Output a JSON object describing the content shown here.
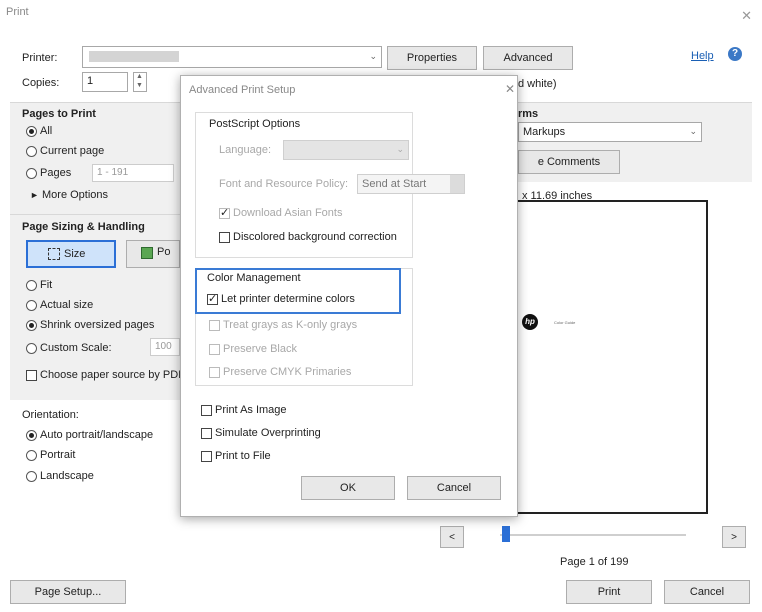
{
  "window": {
    "title": "Print",
    "close": "✕"
  },
  "printer": {
    "label": "Printer:",
    "name": "",
    "properties": "Properties",
    "advanced": "Advanced",
    "help": "Help"
  },
  "copies": {
    "label": "Copies:",
    "value": "1",
    "partial_right": "d white)"
  },
  "pages": {
    "title": "Pages to Print",
    "all": "All",
    "current": "Current page",
    "pages": "Pages",
    "pages_value": "1 - 191",
    "more": "More Options"
  },
  "sizing": {
    "title": "Page Sizing & Handling",
    "size_btn": "Size",
    "poster_btn": "Po",
    "fit": "Fit",
    "actual": "Actual size",
    "shrink": "Shrink oversized pages",
    "custom": "Custom Scale:",
    "custom_value": "100",
    "choose_paper": "Choose paper source by PDF"
  },
  "orientation": {
    "title": "Orientation:",
    "auto": "Auto portrait/landscape",
    "portrait": "Portrait",
    "landscape": "Landscape"
  },
  "right": {
    "forms_title": "rms",
    "markups": "Markups",
    "comments": "e Comments",
    "paper_size": "x 11.69 inches",
    "page_info": "Page 1 of 199",
    "preview_small_text": "Color Guide"
  },
  "footer": {
    "page_setup": "Page Setup...",
    "print": "Print",
    "cancel": "Cancel"
  },
  "dialog": {
    "title": "Advanced Print Setup",
    "close": "✕",
    "postscript": {
      "title": "PostScript Options",
      "language": "Language:",
      "font_policy": "Font and Resource Policy:",
      "font_policy_value": "Send at Start",
      "download_asian": "Download Asian Fonts",
      "discolored": "Discolored background correction"
    },
    "color": {
      "title": "Color Management",
      "let_printer": "Let printer determine colors",
      "treat_grays": "Treat grays as K-only grays",
      "preserve_black": "Preserve Black",
      "preserve_cmyk": "Preserve CMYK Primaries"
    },
    "print_as_image": "Print As Image",
    "simulate": "Simulate Overprinting",
    "print_to_file": "Print to File",
    "ok": "OK",
    "cancel": "Cancel"
  },
  "colors": {
    "accent_blue": "#2b6fd6",
    "help_icon": "#3b78c6",
    "highlight_box": "#3a7bd5"
  }
}
